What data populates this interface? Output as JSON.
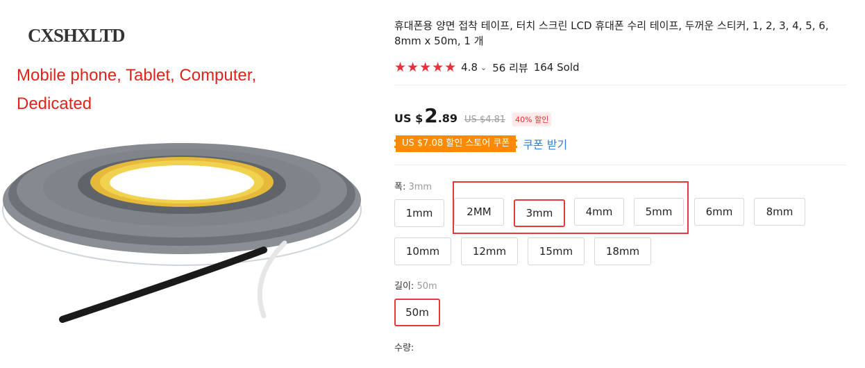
{
  "gallery": {
    "brand": "CXSHXLTD",
    "promo_text": "Mobile phone, Tablet, Computer, Dedicated"
  },
  "product": {
    "title": "휴대폰용 양면 접착 테이프, 터치 스크린 LCD 휴대폰 수리 테이프, 두꺼운 스티커, 1, 2, 3, 4, 5, 6, 8mm x 50m, 1 개",
    "rating": {
      "stars": "★★★★★",
      "score": "4.8",
      "chevron": "⌄",
      "reviews": "56 리뷰",
      "sold": "164 Sold",
      "star_color": "#e8313b"
    },
    "price": {
      "currency": "US $",
      "integer": "2",
      "decimal": ".89",
      "original": "US $4.81",
      "discount": "40% 할인"
    },
    "coupon": {
      "label": "US $7.08 할인 스토어 쿠폰",
      "action": "쿠폰 받기",
      "color": "#ff8a00"
    },
    "width_option": {
      "label": "폭",
      "selected": "3mm",
      "options": [
        "1mm",
        "2MM",
        "3mm",
        "4mm",
        "5mm",
        "6mm",
        "8mm",
        "10mm",
        "12mm",
        "15mm",
        "18mm"
      ]
    },
    "length_option": {
      "label": "길이",
      "selected": "50m",
      "options": [
        "50m"
      ]
    },
    "quantity_label": "수량:"
  },
  "accent_color": "#e8383d"
}
